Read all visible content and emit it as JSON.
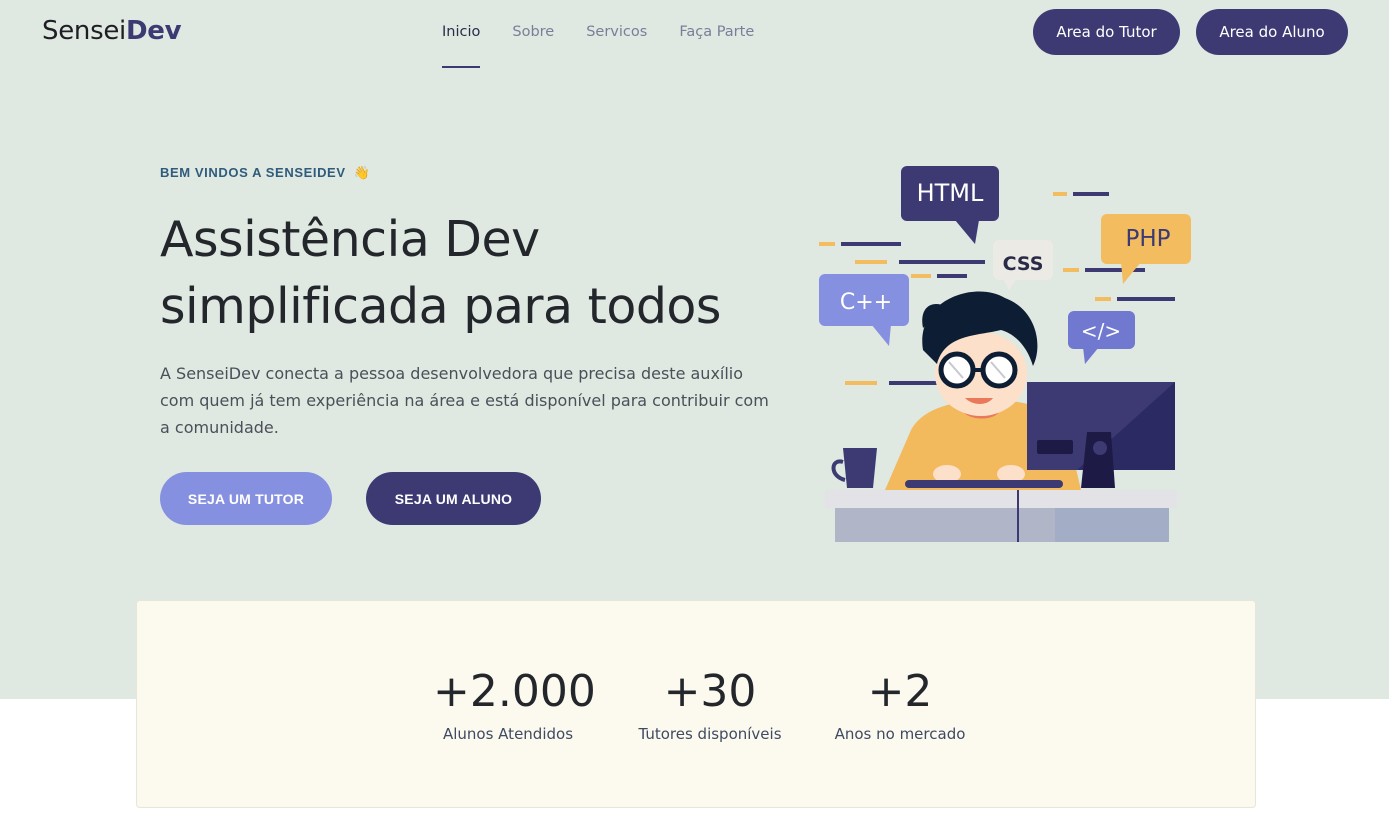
{
  "brand": {
    "prefix": "Sensei",
    "suffix": "Dev"
  },
  "nav": {
    "links": [
      "Inicio",
      "Sobre",
      "Servicos",
      "Faça Parte"
    ],
    "active": "Inicio",
    "buttons": {
      "tutor_area": "Area do Tutor",
      "aluno_area": "Area do Aluno"
    }
  },
  "hero": {
    "eyebrow": "BEM VINDOS A SENSEIDEV",
    "eyebrow_emoji": "👋",
    "headline": "Assistência Dev simplificada para todos",
    "lead": "A SenseiDev conecta a pessoa desenvolvedora que precisa deste auxílio com quem já tem experiência na área e está disponível para contribuir com a comunidade.",
    "cta_tutor": "SEJA UM TUTOR",
    "cta_aluno": "SEJA UM ALUNO"
  },
  "illustration": {
    "tags": [
      "HTML",
      "CSS",
      "PHP",
      "C++",
      "</>"
    ]
  },
  "stats": [
    {
      "value": "+2.000",
      "label": "Alunos Atendidos"
    },
    {
      "value": "+30",
      "label": "Tutores disponíveis"
    },
    {
      "value": "+2",
      "label": "Anos no mercado"
    }
  ],
  "colors": {
    "hero_bg": "#dfe8e1",
    "primary": "#3d3a73",
    "accent": "#8690e0",
    "yellow": "#f3bc5e",
    "card_bg": "#fcf9ef"
  }
}
